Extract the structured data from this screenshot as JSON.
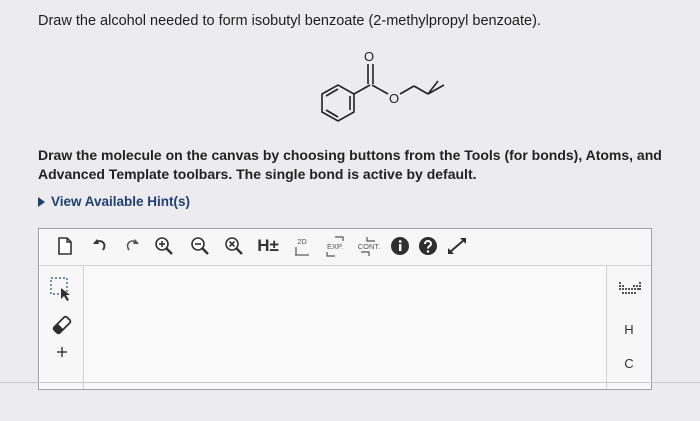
{
  "question": "Draw the alcohol needed to form isobutyl benzoate (2-methylpropyl benzoate).",
  "structure": {
    "carbonyl_oxygen": "O",
    "ester_oxygen": "O"
  },
  "instructions": "Draw the molecule on the canvas by choosing buttons from the Tools (for bonds), Atoms, and Advanced Template toolbars. The single bond is active by default.",
  "hints_link": "View Available Hint(s)",
  "toolbar": {
    "hydrogen_label": "H±",
    "twod_label": "2D",
    "exp_label": "EXP.",
    "cont_label": "CONT."
  },
  "atoms": {
    "h": "H",
    "c": "C"
  },
  "colors": {
    "hint_link": "#1f3f73",
    "toolbar_dark": "#2f2f2f",
    "selection_blue": "#3a6ea5"
  }
}
